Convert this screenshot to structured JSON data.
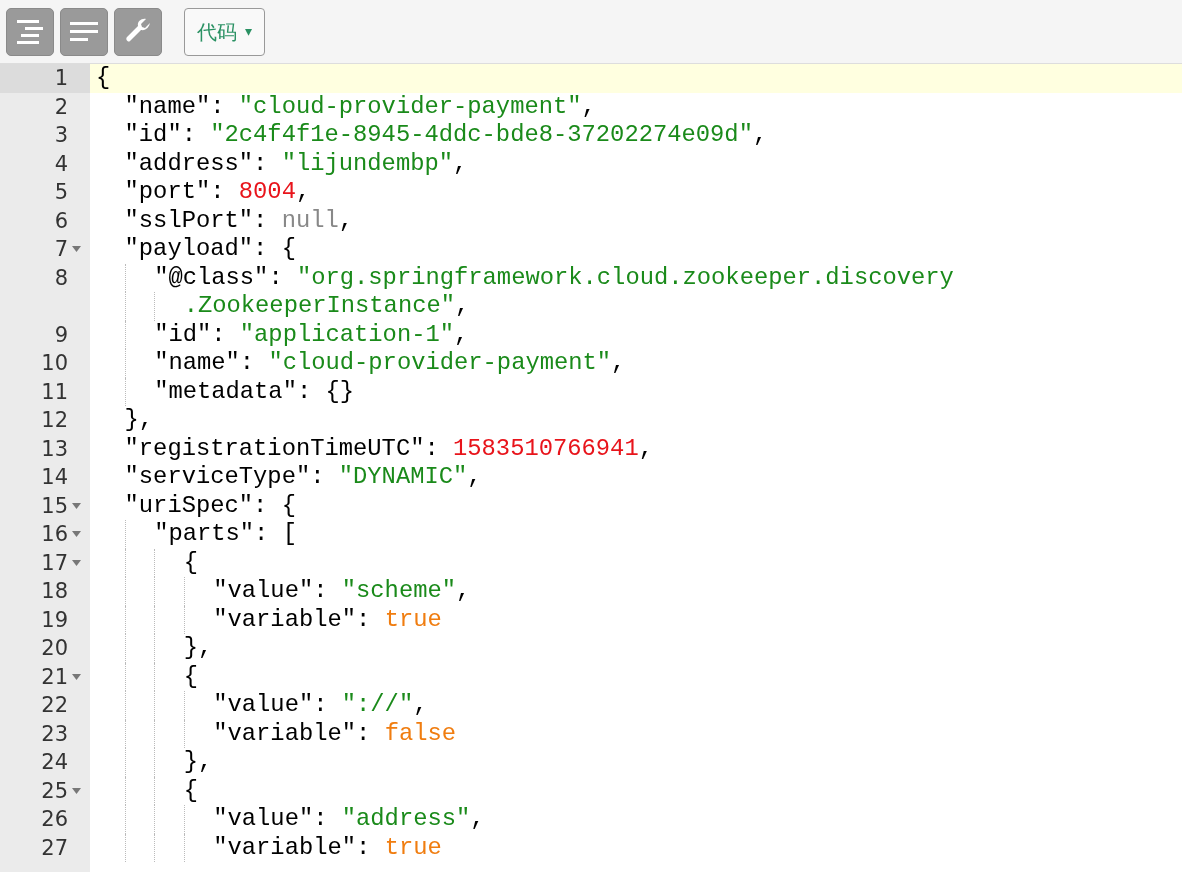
{
  "toolbar": {
    "buttons": [
      {
        "kind": "format"
      },
      {
        "kind": "compact"
      },
      {
        "kind": "repair"
      }
    ],
    "mode_dropdown": {
      "label": "代码",
      "caret": "▾"
    }
  },
  "editor": {
    "lines": [
      {
        "number": "1",
        "fold": false,
        "active": true,
        "tokens": [
          {
            "kind": "punct",
            "text": "{"
          }
        ],
        "children": [
          {
            "number": "2",
            "fold": false,
            "active": false,
            "tokens": [
              {
                "kind": "key",
                "text": "\"name\""
              },
              {
                "kind": "punct",
                "text": ": "
              },
              {
                "kind": "string",
                "text": "\"cloud-provider-payment\""
              },
              {
                "kind": "punct",
                "text": ","
              }
            ]
          },
          {
            "number": "3",
            "fold": false,
            "active": false,
            "tokens": [
              {
                "kind": "key",
                "text": "\"id\""
              },
              {
                "kind": "punct",
                "text": ": "
              },
              {
                "kind": "string",
                "text": "\"2c4f4f1e-8945-4ddc-bde8-37202274e09d\""
              },
              {
                "kind": "punct",
                "text": ","
              }
            ]
          },
          {
            "number": "4",
            "fold": false,
            "active": false,
            "tokens": [
              {
                "kind": "key",
                "text": "\"address\""
              },
              {
                "kind": "punct",
                "text": ": "
              },
              {
                "kind": "string",
                "text": "\"lijundembp\""
              },
              {
                "kind": "punct",
                "text": ","
              }
            ]
          },
          {
            "number": "5",
            "fold": false,
            "active": false,
            "tokens": [
              {
                "kind": "key",
                "text": "\"port\""
              },
              {
                "kind": "punct",
                "text": ": "
              },
              {
                "kind": "number",
                "text": "8004"
              },
              {
                "kind": "punct",
                "text": ","
              }
            ]
          },
          {
            "number": "6",
            "fold": false,
            "active": false,
            "tokens": [
              {
                "kind": "key",
                "text": "\"sslPort\""
              },
              {
                "kind": "punct",
                "text": ": "
              },
              {
                "kind": "null",
                "text": "null"
              },
              {
                "kind": "punct",
                "text": ","
              }
            ]
          },
          {
            "number": "7",
            "fold": true,
            "active": false,
            "tokens": [
              {
                "kind": "key",
                "text": "\"payload\""
              },
              {
                "kind": "punct",
                "text": ": {"
              }
            ],
            "children": [
              {
                "number": "8",
                "fold": false,
                "active": false,
                "tokens": [
                  {
                    "kind": "key",
                    "text": "\"@class\""
                  },
                  {
                    "kind": "punct",
                    "text": ": "
                  },
                  {
                    "kind": "string",
                    "text": "\"org.springframework.cloud.zookeeper.discovery"
                  }
                ],
                "wrapped": [
                  {
                    "kind": "string",
                    "text": ".ZookeeperInstance\""
                  },
                  {
                    "kind": "punct",
                    "text": ","
                  }
                ]
              },
              {
                "number": "9",
                "fold": false,
                "active": false,
                "tokens": [
                  {
                    "kind": "key",
                    "text": "\"id\""
                  },
                  {
                    "kind": "punct",
                    "text": ": "
                  },
                  {
                    "kind": "string",
                    "text": "\"application-1\""
                  },
                  {
                    "kind": "punct",
                    "text": ","
                  }
                ]
              },
              {
                "number": "10",
                "fold": false,
                "active": false,
                "tokens": [
                  {
                    "kind": "key",
                    "text": "\"name\""
                  },
                  {
                    "kind": "punct",
                    "text": ": "
                  },
                  {
                    "kind": "string",
                    "text": "\"cloud-provider-payment\""
                  },
                  {
                    "kind": "punct",
                    "text": ","
                  }
                ]
              },
              {
                "number": "11",
                "fold": false,
                "active": false,
                "tokens": [
                  {
                    "kind": "key",
                    "text": "\"metadata\""
                  },
                  {
                    "kind": "punct",
                    "text": ": {}"
                  }
                ]
              }
            ]
          },
          {
            "number": "12",
            "fold": false,
            "active": false,
            "tokens": [
              {
                "kind": "punct",
                "text": "},"
              }
            ]
          },
          {
            "number": "13",
            "fold": false,
            "active": false,
            "tokens": [
              {
                "kind": "key",
                "text": "\"registrationTimeUTC\""
              },
              {
                "kind": "punct",
                "text": ": "
              },
              {
                "kind": "number",
                "text": "1583510766941"
              },
              {
                "kind": "punct",
                "text": ","
              }
            ]
          },
          {
            "number": "14",
            "fold": false,
            "active": false,
            "tokens": [
              {
                "kind": "key",
                "text": "\"serviceType\""
              },
              {
                "kind": "punct",
                "text": ": "
              },
              {
                "kind": "string",
                "text": "\"DYNAMIC\""
              },
              {
                "kind": "punct",
                "text": ","
              }
            ]
          },
          {
            "number": "15",
            "fold": true,
            "active": false,
            "tokens": [
              {
                "kind": "key",
                "text": "\"uriSpec\""
              },
              {
                "kind": "punct",
                "text": ": {"
              }
            ],
            "children": [
              {
                "number": "16",
                "fold": true,
                "active": false,
                "tokens": [
                  {
                    "kind": "key",
                    "text": "\"parts\""
                  },
                  {
                    "kind": "punct",
                    "text": ": ["
                  }
                ],
                "children": [
                  {
                    "number": "17",
                    "fold": true,
                    "active": false,
                    "tokens": [
                      {
                        "kind": "punct",
                        "text": "{"
                      }
                    ],
                    "children": [
                      {
                        "number": "18",
                        "fold": false,
                        "active": false,
                        "tokens": [
                          {
                            "kind": "key",
                            "text": "\"value\""
                          },
                          {
                            "kind": "punct",
                            "text": ": "
                          },
                          {
                            "kind": "string",
                            "text": "\"scheme\""
                          },
                          {
                            "kind": "punct",
                            "text": ","
                          }
                        ]
                      },
                      {
                        "number": "19",
                        "fold": false,
                        "active": false,
                        "tokens": [
                          {
                            "kind": "key",
                            "text": "\"variable\""
                          },
                          {
                            "kind": "punct",
                            "text": ": "
                          },
                          {
                            "kind": "bool",
                            "text": "true"
                          }
                        ]
                      }
                    ]
                  },
                  {
                    "number": "20",
                    "fold": false,
                    "active": false,
                    "tokens": [
                      {
                        "kind": "punct",
                        "text": "},"
                      }
                    ]
                  },
                  {
                    "number": "21",
                    "fold": true,
                    "active": false,
                    "tokens": [
                      {
                        "kind": "punct",
                        "text": "{"
                      }
                    ],
                    "children": [
                      {
                        "number": "22",
                        "fold": false,
                        "active": false,
                        "tokens": [
                          {
                            "kind": "key",
                            "text": "\"value\""
                          },
                          {
                            "kind": "punct",
                            "text": ": "
                          },
                          {
                            "kind": "string",
                            "text": "\"://\""
                          },
                          {
                            "kind": "punct",
                            "text": ","
                          }
                        ]
                      },
                      {
                        "number": "23",
                        "fold": false,
                        "active": false,
                        "tokens": [
                          {
                            "kind": "key",
                            "text": "\"variable\""
                          },
                          {
                            "kind": "punct",
                            "text": ": "
                          },
                          {
                            "kind": "bool",
                            "text": "false"
                          }
                        ]
                      }
                    ]
                  },
                  {
                    "number": "24",
                    "fold": false,
                    "active": false,
                    "tokens": [
                      {
                        "kind": "punct",
                        "text": "},"
                      }
                    ]
                  },
                  {
                    "number": "25",
                    "fold": true,
                    "active": false,
                    "tokens": [
                      {
                        "kind": "punct",
                        "text": "{"
                      }
                    ],
                    "children": [
                      {
                        "number": "26",
                        "fold": false,
                        "active": false,
                        "tokens": [
                          {
                            "kind": "key",
                            "text": "\"value\""
                          },
                          {
                            "kind": "punct",
                            "text": ": "
                          },
                          {
                            "kind": "string",
                            "text": "\"address\""
                          },
                          {
                            "kind": "punct",
                            "text": ","
                          }
                        ]
                      },
                      {
                        "number": "27",
                        "fold": false,
                        "active": false,
                        "tokens": [
                          {
                            "kind": "key",
                            "text": "\"variable\""
                          },
                          {
                            "kind": "punct",
                            "text": ": "
                          },
                          {
                            "kind": "bool",
                            "text": "true"
                          }
                        ]
                      }
                    ]
                  }
                ]
              }
            ]
          }
        ]
      }
    ]
  }
}
